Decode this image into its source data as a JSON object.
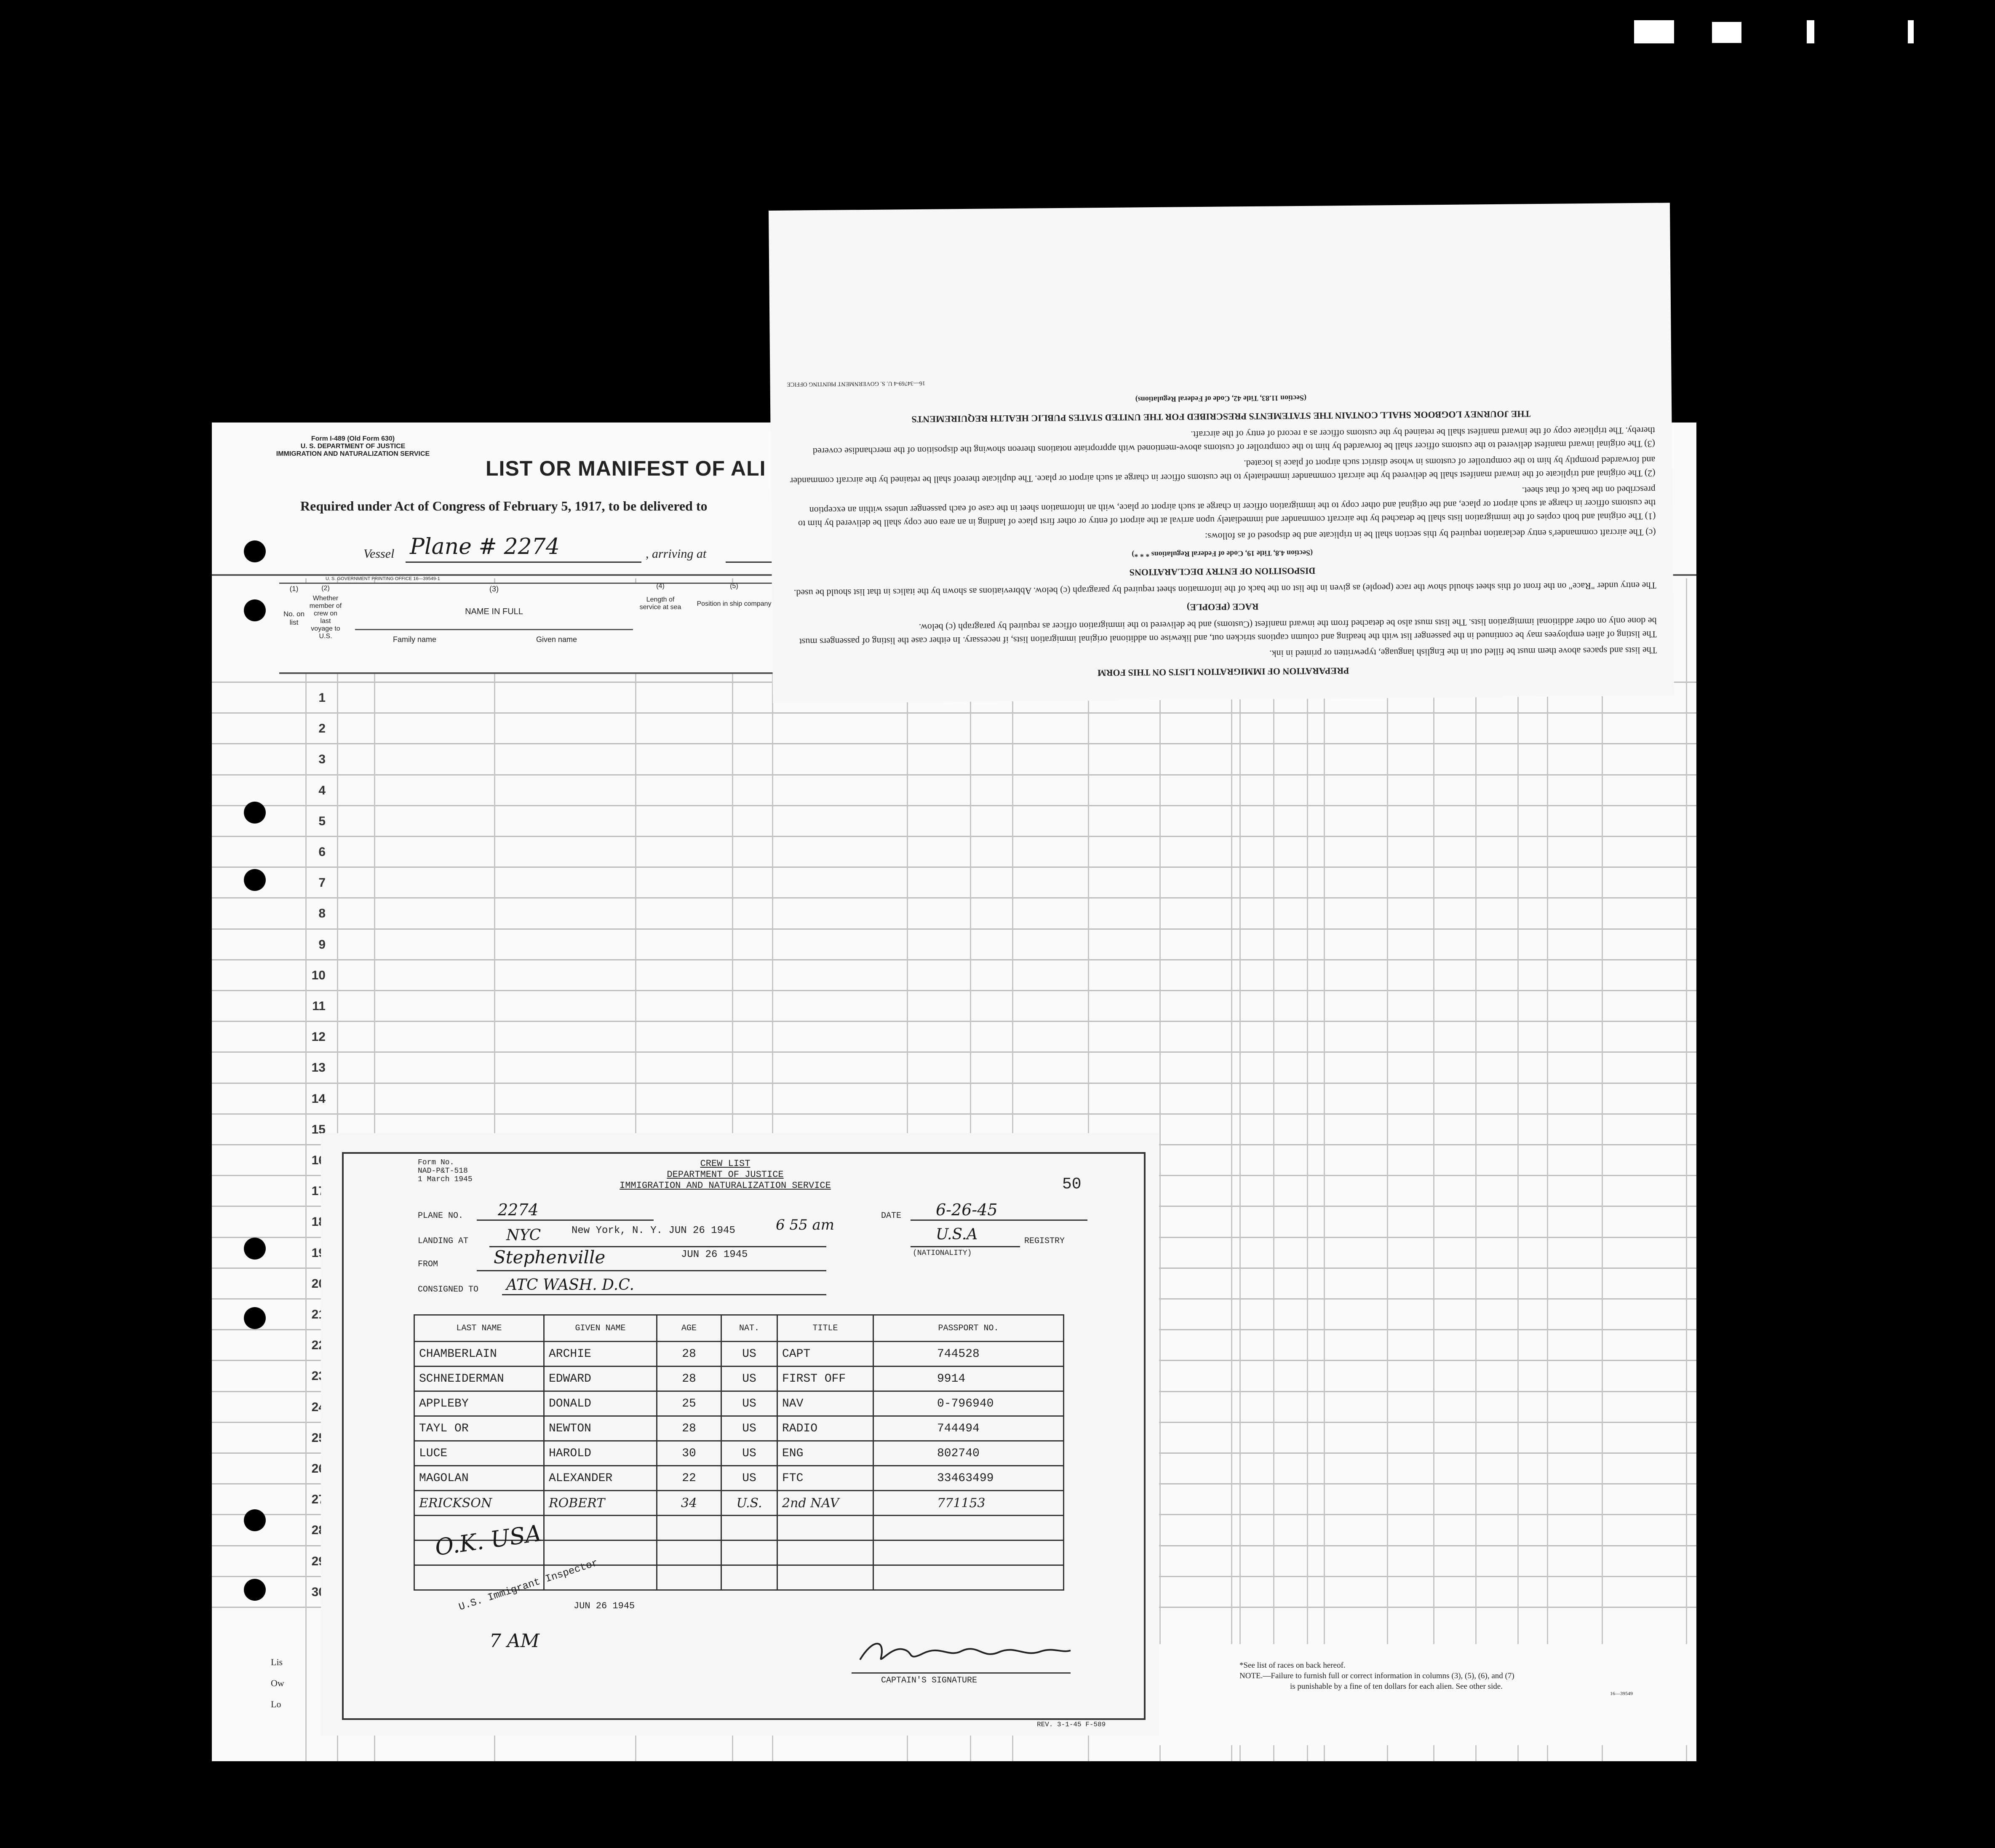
{
  "manifest": {
    "form_id_1": "Form I-489 (Old Form 630)",
    "form_id_2": "U. S. DEPARTMENT OF JUSTICE",
    "form_id_3": "IMMIGRATION AND NATURALIZATION SERVICE",
    "title": "LIST OR MANIFEST OF ALI",
    "subtitle": "Required under Act of Congress of February 5, 1917, to be delivered to",
    "vessel_label": "Vessel",
    "vessel_value": "Plane # 2274",
    "arriving_label": ", arriving at",
    "printing_note": "U. S. GOVERNMENT PRINTING OFFICE   16—39549-1",
    "columns": [
      {
        "num": "(1)",
        "label": "No. on list"
      },
      {
        "num": "(2)",
        "label": "Whether member of crew on last voyage to U.S."
      },
      {
        "num": "(3)",
        "label": "NAME IN FULL"
      },
      {
        "num": "(4)",
        "label": "Length of service at sea"
      },
      {
        "num": "(5)",
        "label": "Position in ship company"
      }
    ],
    "family_name": "Family name",
    "given_name": "Given name",
    "row_numbers": [
      "1",
      "2",
      "3",
      "4",
      "5",
      "6",
      "7",
      "8",
      "9",
      "10",
      "11",
      "12",
      "13",
      "14",
      "15",
      "16",
      "17",
      "18",
      "19",
      "20",
      "21",
      "22",
      "23",
      "24",
      "25",
      "26",
      "27",
      "28",
      "29",
      "30"
    ],
    "bottom_left": [
      "Lis",
      "Ow",
      "Lo"
    ],
    "footnote_1": "*See list of races on back hereof.",
    "footnote_2": "NOTE.—Failure to furnish full or correct information in columns (3), (5), (6), and (7)",
    "footnote_3": "is punishable by a fine of ten dollars for each alien.  See other side.",
    "footnote_code": "16—39549"
  },
  "flap": {
    "header": "PREPARATION OF IMMIGRATION LISTS ON THIS FORM",
    "p1": "The lists and spaces above them must be filled out in the English language, typewritten or printed in ink.",
    "p2": "The listing of alien employees may be continued in the passenger list with the heading and column captions stricken out, and likewise on additional original immigration lists, if necessary. In either case the listing of passengers must be done only on other additional immigration lists. The lists must also be detached from the inward manifest (Customs) and be delivered to the immigration officer as required by paragraph (c) below.",
    "race_header": "RACE (PEOPLE)",
    "p3": "The entry under \"Race\" on the front of this sheet should show the race (people) as given in the list on the back of the information sheet required by paragraph (c) below. Abbreviations as shown by the italics in that list should be used.",
    "disp_header": "DISPOSITION OF ENTRY DECLARATIONS",
    "disp_sub": "(Section 4.8, Title 19, Code of Federal Regulations * * *)",
    "p4": "(c) The aircraft commander's entry declaration required by this section shall be in triplicate and be disposed of as follows:",
    "p5": "(1) The original and both copies of the immigration lists shall be detached by the aircraft commander and immediately upon arrival at the airport of entry or other first place of landing in an area one copy shall be delivered by him to the customs officer in charge at such airport or place, and the original and other copy to the immigration officer in charge at such airport or place, with an information sheet in the case of each passenger unless within an exception prescribed on the back of that sheet.",
    "p6": "(2) The original and triplicate of the inward manifest shall be delivered by the aircraft commander immediately to the customs officer in charge at such airport or place. The duplicate thereof shall be retained by the aircraft commander and forwarded promptly by him to the comptroller of customs in whose district such airport of place is located.",
    "p7": "(3) The original inward manifest delivered to the customs officer shall be forwarded by him to the comptroller of customs above-mentioned with appropriate notations thereon showing the disposition of the merchandise covered thereby. The triplicate copy of the inward manifest shall be retained by the customs officer as a record of entry of the aircraft.",
    "journey_header": "THE JOURNEY LOGBOOK SHALL CONTAIN THE STATEMENTS PRESCRIBED FOR THE UNITED STATES PUBLIC HEALTH REQUIREMENTS",
    "journey_sub": "(Section 11.83, Title 42, Code of Federal Regulations)",
    "printing": "16—34769-4    U. S. GOVERNMENT PRINTING OFFICE"
  },
  "crew_list": {
    "form_no_1": "Form No.",
    "form_no_2": "NAD-P&T-518",
    "form_no_3": "1 March 1945",
    "title": "CREW LIST",
    "dept": "DEPARTMENT OF JUSTICE",
    "service": "IMMIGRATION AND NATURALIZATION SERVICE",
    "page_number": "50",
    "plane_label": "PLANE NO.",
    "plane_value": "2274",
    "date_label": "DATE",
    "date_value": "6-26-45",
    "landing_label": "LANDING AT",
    "landing_value": "NYC",
    "landing_stamp": "New York, N. Y.   JUN 26 1945",
    "landing_time": "6 55 am",
    "registry_value": "U.S.A",
    "registry_label": "REGISTRY",
    "nationality_label": "(NATIONALITY)",
    "from_label": "FROM",
    "from_value": "Stephenville",
    "from_stamp": "JUN 26 1945",
    "consigned_label": "CONSIGNED TO",
    "consigned_value": "ATC WASH. D.C.",
    "headers": [
      "LAST NAME",
      "GIVEN NAME",
      "AGE",
      "NAT.",
      "TITLE",
      "PASSPORT NO."
    ],
    "rows": [
      [
        "CHAMBERLAIN",
        "ARCHIE",
        "28",
        "US",
        "CAPT",
        "744528"
      ],
      [
        "SCHNEIDERMAN",
        "EDWARD",
        "28",
        "US",
        "FIRST OFF",
        "9914"
      ],
      [
        "APPLEBY",
        "DONALD",
        "25",
        "US",
        "NAV",
        "0-796940"
      ],
      [
        "TAYL OR",
        "NEWTON",
        "28",
        "US",
        "RADIO",
        "744494"
      ],
      [
        "LUCE",
        "HAROLD",
        "30",
        "US",
        "ENG",
        "802740"
      ],
      [
        "MAGOLAN",
        "ALEXANDER",
        "22",
        "US",
        "FTC",
        "33463499"
      ],
      [
        "ERICKSON",
        "ROBERT",
        "34",
        "U.S.",
        "2nd NAV",
        "771153"
      ],
      [
        "",
        "",
        "",
        "",
        "",
        ""
      ],
      [
        "",
        "",
        "",
        "",
        "",
        ""
      ],
      [
        "",
        "",
        "",
        "",
        "",
        ""
      ]
    ],
    "inspector_note": "O.K. USA",
    "inspector_stamp": "U.S. Immigrant Inspector",
    "inspector_date": "JUN 26 1945",
    "inspector_time": "7 AM",
    "captain_label": "CAPTAIN'S SIGNATURE",
    "rev": "REV. 3-1-45 F-589"
  }
}
